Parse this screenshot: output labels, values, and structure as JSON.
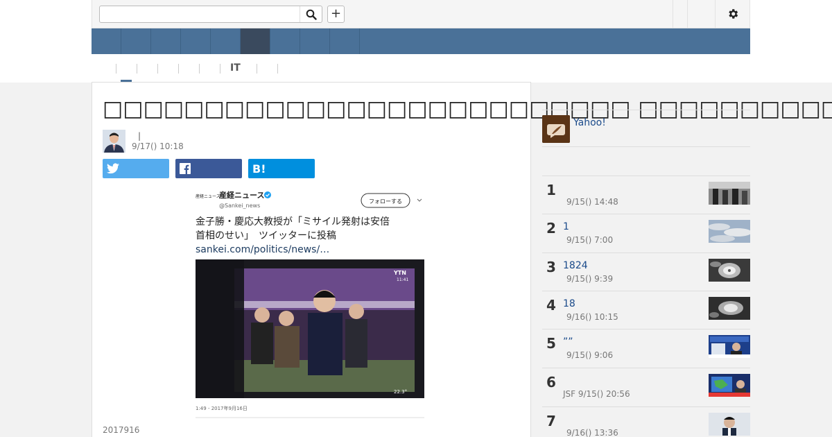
{
  "search": {
    "value": "",
    "placeholder": ""
  },
  "toolbar": {
    "plus_label": "+"
  },
  "subnav": {
    "it_label": "IT"
  },
  "article": {
    "title": "□□□□□□□□□□□□□□□□□□□□□□□□□□ □□□□□□□□□□",
    "author_separator": "|",
    "date": "9/17() 10:18",
    "caption": "2017916"
  },
  "share": {
    "hatena_label": "B!"
  },
  "tweet": {
    "account_name": "産経ニュース",
    "handle": "@Sankei_news",
    "follow_label": "フォローする",
    "logo_text": "産経ニュース",
    "text_line1": "金子勝・慶応大教授が「ミサイル発射は安倍",
    "text_line2": "首相のせい」　ツイッターに投稿",
    "link": "sankei.com/politics/news/…",
    "photo_label": "YTN",
    "photo_time": "11:41",
    "photo_temp": "22.3°",
    "timestamp": "1:49 - 2017年9月16日"
  },
  "sidebar": {
    "yahoo_label": "Yahoo!",
    "ranking": [
      {
        "num": "1",
        "title": "",
        "meta": "9/15() 14:48"
      },
      {
        "num": "2",
        "title": "1",
        "meta": "9/15() 7:00"
      },
      {
        "num": "3",
        "title": "1824",
        "meta": "9/15() 9:39"
      },
      {
        "num": "4",
        "title": "18",
        "meta": "9/16() 10:15"
      },
      {
        "num": "5",
        "title": "””",
        "meta": "9/15() 9:06"
      },
      {
        "num": "6",
        "title": "",
        "meta": "JSF 9/15() 20:56"
      },
      {
        "num": "7",
        "title": "",
        "meta": "9/16() 13:36"
      }
    ]
  },
  "colors": {
    "nav": "#4a7198",
    "nav_active": "#3a4a5e",
    "link": "#1a4a8a",
    "twitter": "#55acee",
    "facebook": "#3b5998",
    "hatena": "#008fde"
  }
}
